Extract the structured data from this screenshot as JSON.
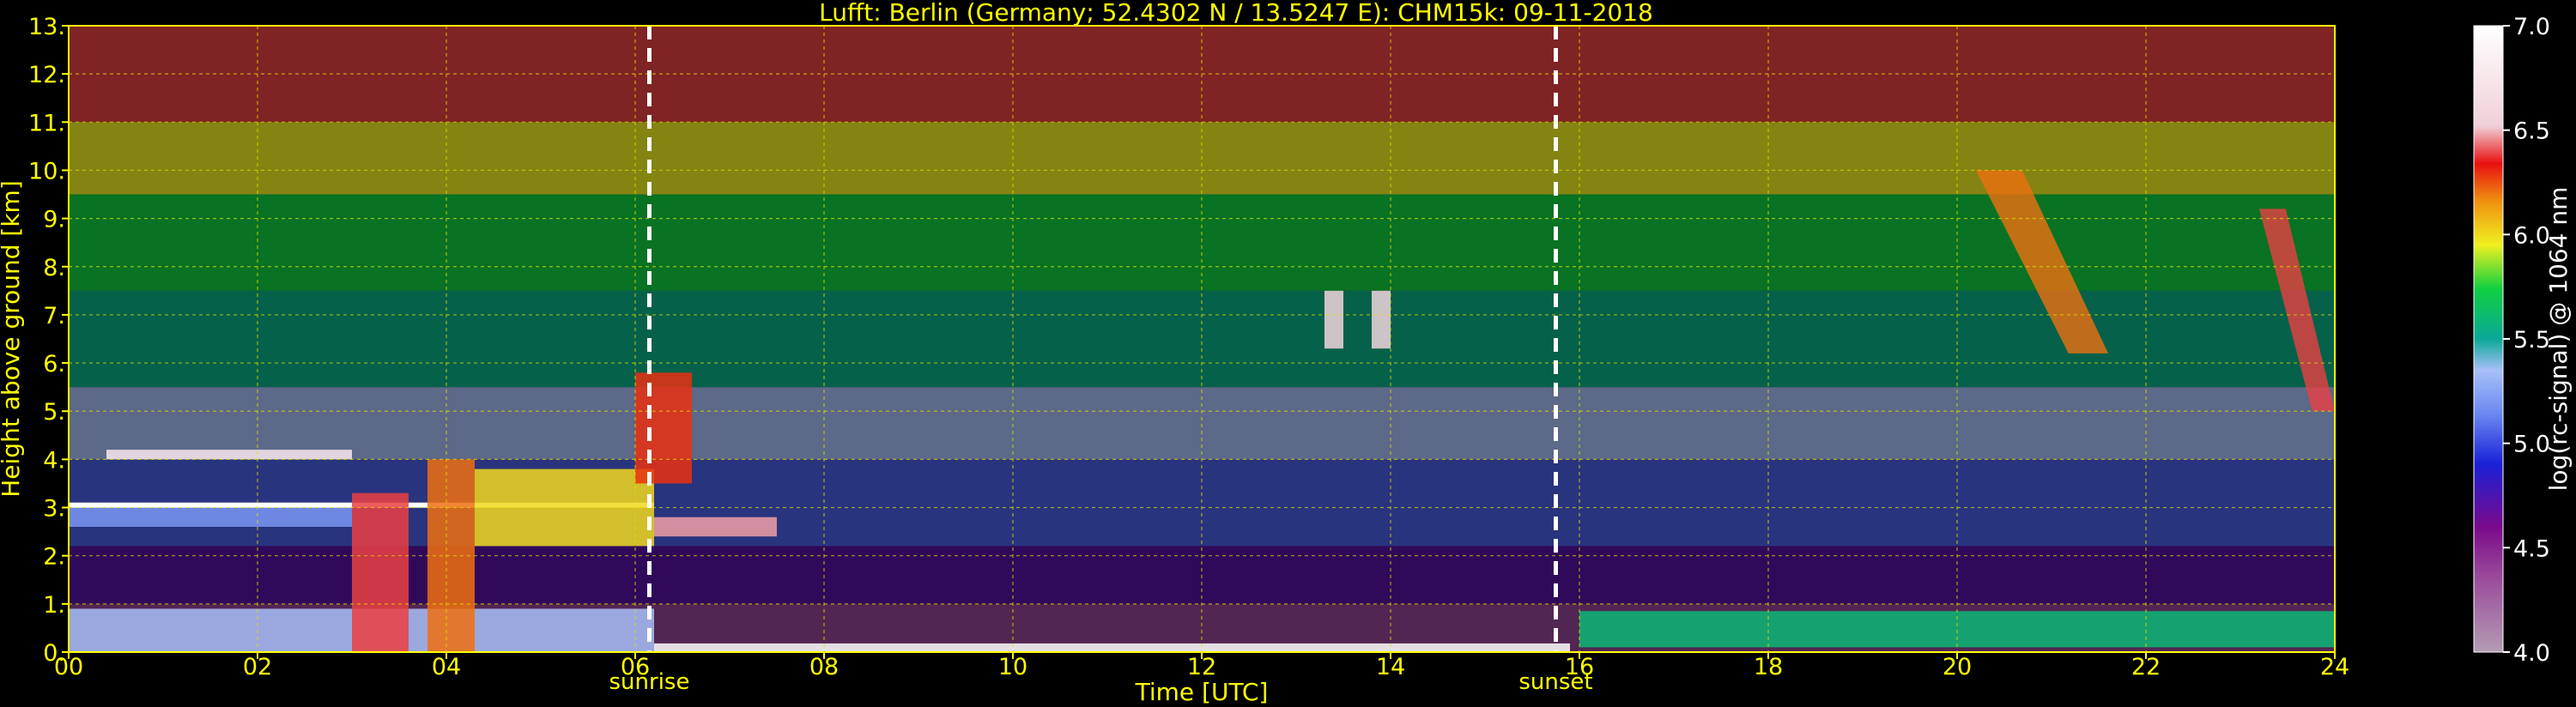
{
  "chart_data": {
    "type": "heatmap",
    "title": "Lufft: Berlin (Germany; 52.4302 N / 13.5247 E):    CHM15k: 09-11-2018",
    "xlabel": "Time [UTC]",
    "ylabel": "Height above ground [km]",
    "colorbar_label": "log(rc-signal) @ 1064 nm",
    "xlim": [
      0,
      24
    ],
    "ylim": [
      0,
      13
    ],
    "x_ticks": [
      "00",
      "02",
      "04",
      "06",
      "08",
      "10",
      "12",
      "14",
      "16",
      "18",
      "20",
      "22",
      "24"
    ],
    "y_ticks": [
      "0.",
      "1.",
      "2.",
      "3.",
      "4.",
      "5.",
      "6.",
      "7.",
      "8.",
      "9.",
      "10.",
      "11.",
      "12.",
      "13."
    ],
    "colorbar_range": [
      4.0,
      7.0
    ],
    "colorbar_ticks": [
      "4.0",
      "4.5",
      "5.0",
      "5.5",
      "6.0",
      "6.5",
      "7.0"
    ],
    "grid": true,
    "annotations": [
      {
        "label": "sunrise",
        "x": 6.15
      },
      {
        "label": "sunset",
        "x": 15.75
      }
    ],
    "features": [
      {
        "kind": "boundary_layer",
        "t0": 0.0,
        "t1": 6.2,
        "h0": 0.0,
        "h1": 0.9,
        "level": 5.35
      },
      {
        "kind": "cloud_layer",
        "t0": 0.0,
        "t1": 3.0,
        "h0": 2.6,
        "h1": 3.1,
        "level": 5.2
      },
      {
        "kind": "cloud_top",
        "t0": 0.0,
        "t1": 6.2,
        "h": 3.05,
        "level": 7.0
      },
      {
        "kind": "cloud_layer",
        "t0": 0.4,
        "t1": 3.0,
        "h0": 4.0,
        "h1": 4.2,
        "level": 6.8
      },
      {
        "kind": "cloud_column",
        "t0": 3.0,
        "t1": 3.6,
        "h0": 0.0,
        "h1": 3.3,
        "level": 6.4
      },
      {
        "kind": "cloud_column",
        "t0": 3.8,
        "t1": 4.3,
        "h0": 0.0,
        "h1": 4.0,
        "level": 6.2
      },
      {
        "kind": "cloud_layer",
        "t0": 4.3,
        "t1": 6.2,
        "h0": 2.2,
        "h1": 3.8,
        "level": 6.0
      },
      {
        "kind": "cloud_layer",
        "t0": 6.2,
        "t1": 7.5,
        "h0": 2.4,
        "h1": 2.8,
        "level": 6.5
      },
      {
        "kind": "cloud_column",
        "t0": 6.0,
        "t1": 6.6,
        "h0": 3.5,
        "h1": 5.8,
        "level": 6.3
      },
      {
        "kind": "surface_layer",
        "t0": 6.2,
        "t1": 15.9,
        "h0": 0.0,
        "h1": 0.18,
        "level": 7.0
      },
      {
        "kind": "cloud_column",
        "t0": 13.3,
        "t1": 13.5,
        "h0": 6.3,
        "h1": 7.5,
        "level": 6.6
      },
      {
        "kind": "cloud_column",
        "t0": 13.8,
        "t1": 14.0,
        "h0": 6.3,
        "h1": 7.5,
        "level": 6.6
      },
      {
        "kind": "boundary_layer",
        "t0": 16.0,
        "t1": 24.0,
        "h0": 0.1,
        "h1": 0.85,
        "level": 5.6
      },
      {
        "kind": "cirrus",
        "t0": 20.2,
        "t1": 21.6,
        "h0": 6.2,
        "h1": 10.0,
        "level": 6.2
      },
      {
        "kind": "cirrus",
        "t0": 23.2,
        "t1": 24.0,
        "h0": 5.0,
        "h1": 9.2,
        "level": 6.4
      }
    ]
  }
}
